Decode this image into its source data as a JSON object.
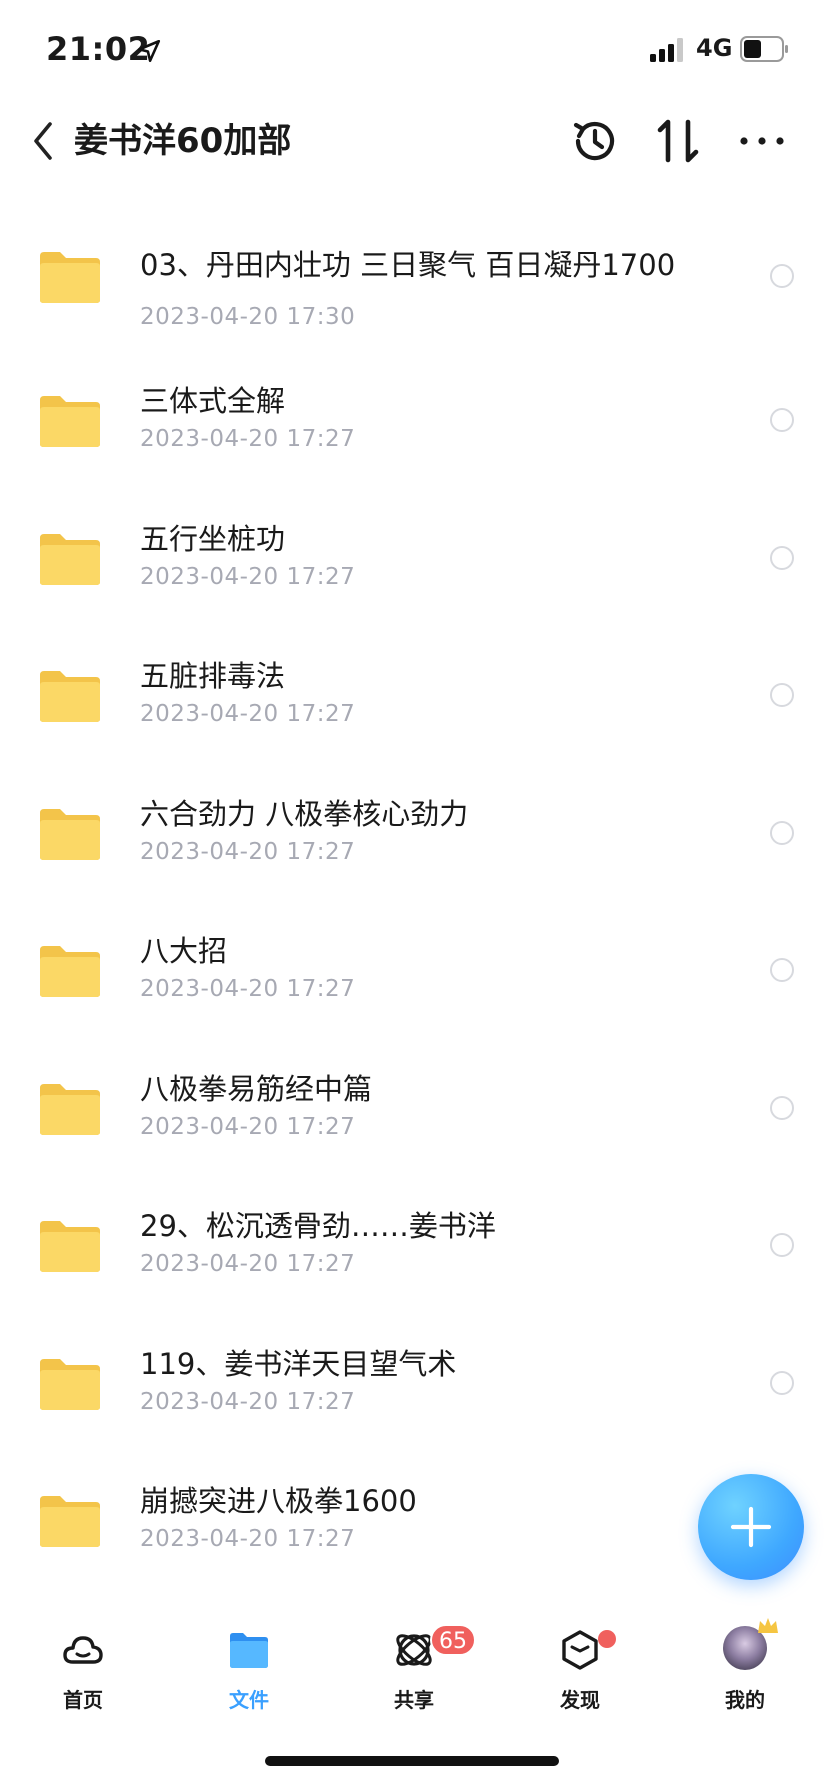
{
  "status_bar": {
    "time": "21:02",
    "network": "4G"
  },
  "nav": {
    "title": "姜书洋60加部"
  },
  "files": [
    {
      "name": "03、丹田内壮功 三日聚气 百日凝丹1700",
      "date": "2023-04-20 17:30"
    },
    {
      "name": "三体式全解",
      "date": "2023-04-20 17:27"
    },
    {
      "name": "五行坐桩功",
      "date": "2023-04-20 17:27"
    },
    {
      "name": "五脏排毒法",
      "date": "2023-04-20 17:27"
    },
    {
      "name": "六合劲力 八极拳核心劲力",
      "date": "2023-04-20 17:27"
    },
    {
      "name": "八大招",
      "date": "2023-04-20 17:27"
    },
    {
      "name": "八极拳易筋经中篇",
      "date": "2023-04-20 17:27"
    },
    {
      "name": "29、松沉透骨劲……姜书洋",
      "date": "2023-04-20 17:27"
    },
    {
      "name": "119、姜书洋天目望气术",
      "date": "2023-04-20 17:27"
    },
    {
      "name": "崩撼突进八极拳1600",
      "date": "2023-04-20 17:27"
    }
  ],
  "tabs": [
    {
      "label": "首页",
      "icon": "cloud-icon"
    },
    {
      "label": "文件",
      "icon": "folder-icon",
      "active": true
    },
    {
      "label": "共享",
      "icon": "share-orbit-icon",
      "badge": "65"
    },
    {
      "label": "发现",
      "icon": "cube-icon",
      "dot": true
    },
    {
      "label": "我的",
      "icon": "avatar"
    }
  ],
  "colors": {
    "accent": "#3aa0ff",
    "badge": "#f0605d",
    "folder": "#f9d35c",
    "secondary_text": "#a7a9b3"
  }
}
